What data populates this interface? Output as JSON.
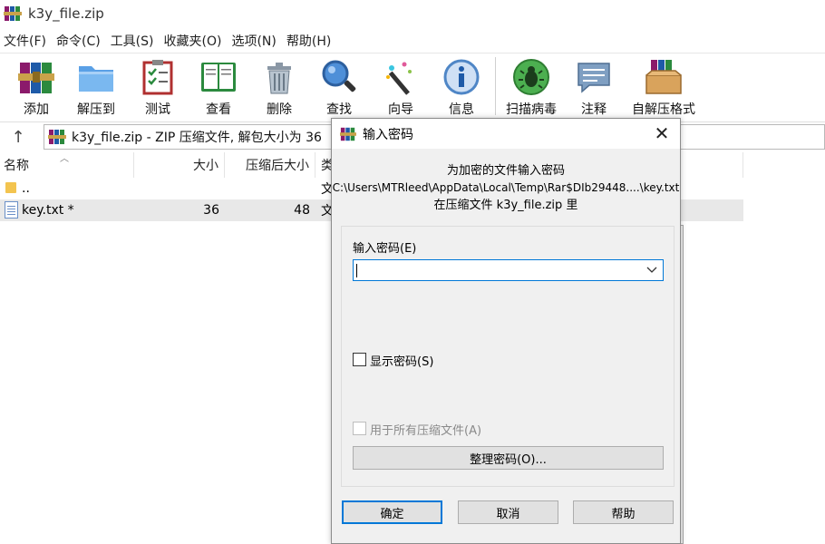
{
  "window": {
    "title": "k3y_file.zip"
  },
  "menu": [
    "文件(F)",
    "命令(C)",
    "工具(S)",
    "收藏夹(O)",
    "选项(N)",
    "帮助(H)"
  ],
  "toolbar": {
    "add": "添加",
    "extract_to": "解压到",
    "test": "测试",
    "view": "查看",
    "delete": "删除",
    "find": "查找",
    "wizard": "向导",
    "info": "信息",
    "virus_scan": "扫描病毒",
    "comment": "注释",
    "sfx": "自解压格式"
  },
  "address": {
    "text": "k3y_file.zip - ZIP 压缩文件, 解包大小为 36"
  },
  "columns": {
    "name": "名称",
    "size": "大小",
    "packed": "压缩后大小",
    "type": "类"
  },
  "rows": [
    {
      "name": "..",
      "size": "",
      "packed": "",
      "type": "文"
    },
    {
      "name": "key.txt *",
      "size": "36",
      "packed": "48",
      "type": "文"
    }
  ],
  "dialog": {
    "title": "输入密码",
    "info_line1": "为加密的文件输入密码",
    "info_line2": "C:\\Users\\MTRleed\\AppData\\Local\\Temp\\Rar$DIb29448....\\key.txt",
    "info_line3": "在压缩文件 k3y_file.zip 里",
    "password_label": "输入密码(E)",
    "password_value": "",
    "show_password": "显示密码(S)",
    "use_for_all": "用于所有压缩文件(A)",
    "organize": "整理密码(O)...",
    "ok": "确定",
    "cancel": "取消",
    "help": "帮助",
    "close_glyph": "✕"
  }
}
